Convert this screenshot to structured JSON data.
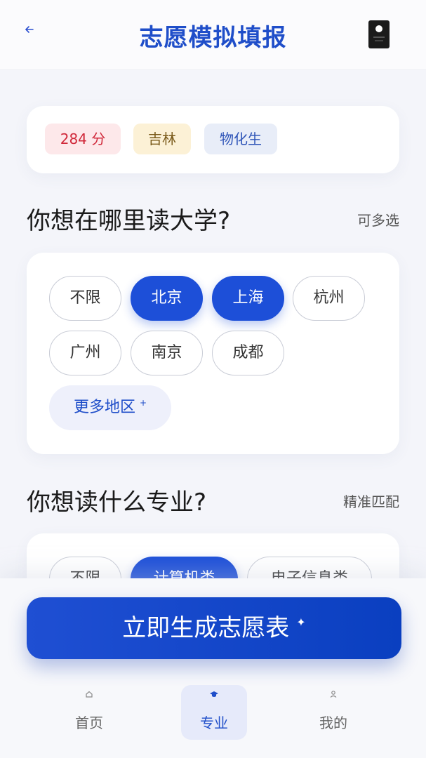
{
  "header": {
    "title": "志愿模拟填报",
    "back_icon": "arrow-left-icon",
    "profile_icon": "id-card-icon"
  },
  "info": {
    "score": "284 分",
    "province": "吉林",
    "subjects": "物化生"
  },
  "region_section": {
    "title": "你想在哪里读大学?",
    "hint": "可多选",
    "chips": [
      {
        "label": "不限",
        "selected": false
      },
      {
        "label": "北京",
        "selected": true
      },
      {
        "label": "上海",
        "selected": true
      },
      {
        "label": "杭州",
        "selected": false
      },
      {
        "label": "广州",
        "selected": false
      },
      {
        "label": "南京",
        "selected": false
      },
      {
        "label": "成都",
        "selected": false
      }
    ],
    "more_label": "更多地区",
    "more_mark": "+"
  },
  "major_section": {
    "title": "你想读什么专业?",
    "hint": "精准匹配",
    "chips": [
      {
        "label": "不限",
        "selected": false
      },
      {
        "label": "计算机类",
        "selected": true
      },
      {
        "label": "电子信息类",
        "selected": false
      }
    ]
  },
  "cta": {
    "label": "立即生成志愿表",
    "icon": "sparkle-icon"
  },
  "bottom_nav": [
    {
      "label": "首页",
      "icon": "home-icon",
      "active": false
    },
    {
      "label": "专业",
      "icon": "graduation-cap-icon",
      "active": true
    },
    {
      "label": "我的",
      "icon": "user-icon",
      "active": false
    }
  ],
  "colors": {
    "primary": "#1d4fd8",
    "title": "#1f4ec9",
    "score_tag_bg": "#fde8ea",
    "province_tag_bg": "#fcf1d6",
    "subjects_tag_bg": "#e8edf8"
  }
}
